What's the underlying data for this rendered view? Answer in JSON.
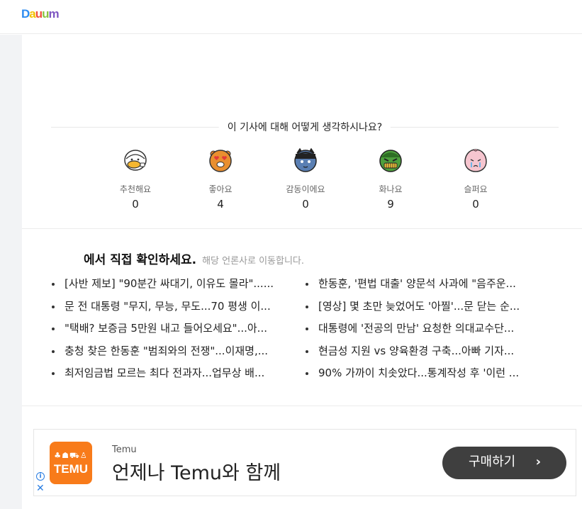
{
  "header": {
    "logo_parts": [
      "D",
      "a",
      "u",
      "u",
      "m"
    ]
  },
  "reactions": {
    "title": "이 기사에 대해 어떻게 생각하시나요?",
    "items": [
      {
        "label": "추천해요",
        "count": "0",
        "icon": "recommend-face-icon"
      },
      {
        "label": "좋아요",
        "count": "4",
        "icon": "like-face-icon"
      },
      {
        "label": "감동이에요",
        "count": "0",
        "icon": "touched-face-icon"
      },
      {
        "label": "화나요",
        "count": "9",
        "icon": "angry-face-icon"
      },
      {
        "label": "슬퍼요",
        "count": "0",
        "icon": "sad-face-icon"
      }
    ]
  },
  "press": {
    "title": "에서 직접 확인하세요.",
    "subtitle": "해당 언론사로 이동합니다.",
    "left_articles": [
      "[사반 제보] \"90분간 싸대기, 이유도 몰라\"......",
      "문 전 대통령 \"무지, 무능, 무도...70 평생 이...",
      "\"택배? 보증금 5만원 내고 들어오세요\"...아...",
      "충청 찾은 한동훈 \"범죄와의 전쟁\"...이재명,...",
      "최저임금법 모르는 최다 전과자...업무상 배..."
    ],
    "right_articles": [
      "한동훈, '편법 대출' 양문석 사과에 \"음주운...",
      "[영상] 몇 초만 늦었어도 '아찔'...문 닫는 순...",
      "대통령에 '전공의 만남' 요청한 의대교수단...",
      "현금성 지원 vs 양육환경 구축...아빠 기자...",
      "90% 가까이 치솟았다...통계작성 후 '이런 ..."
    ]
  },
  "ad": {
    "logo_icons": "♣☗⛟♙",
    "logo_text": "TEMU",
    "sponsor": "Temu",
    "headline": "언제나 Temu와 함께",
    "cta_label": "구매하기",
    "cta_icon": "chevron-right-icon",
    "info_icon": "info-icon",
    "close_icon": "close-icon"
  }
}
